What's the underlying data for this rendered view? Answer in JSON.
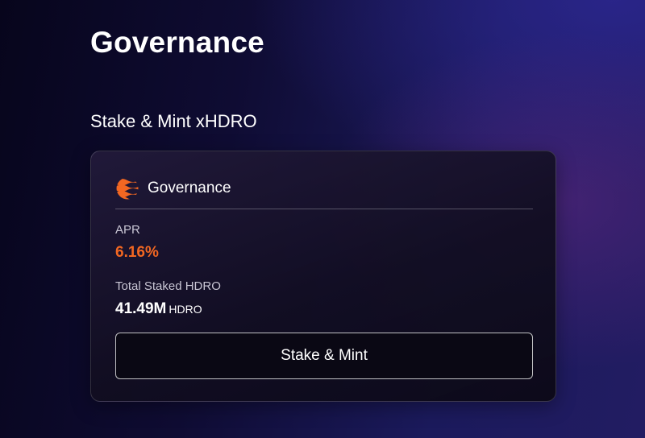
{
  "page": {
    "title": "Governance"
  },
  "section": {
    "title": "Stake & Mint xHDRO"
  },
  "card": {
    "title": "Governance",
    "logo_icon": "hydro-logo-icon",
    "accent_color": "#f26722",
    "apr": {
      "label": "APR",
      "value": "6.16%"
    },
    "total_staked": {
      "label": "Total Staked HDRO",
      "amount": "41.49M",
      "unit": "HDRO"
    },
    "button_label": "Stake & Mint"
  }
}
